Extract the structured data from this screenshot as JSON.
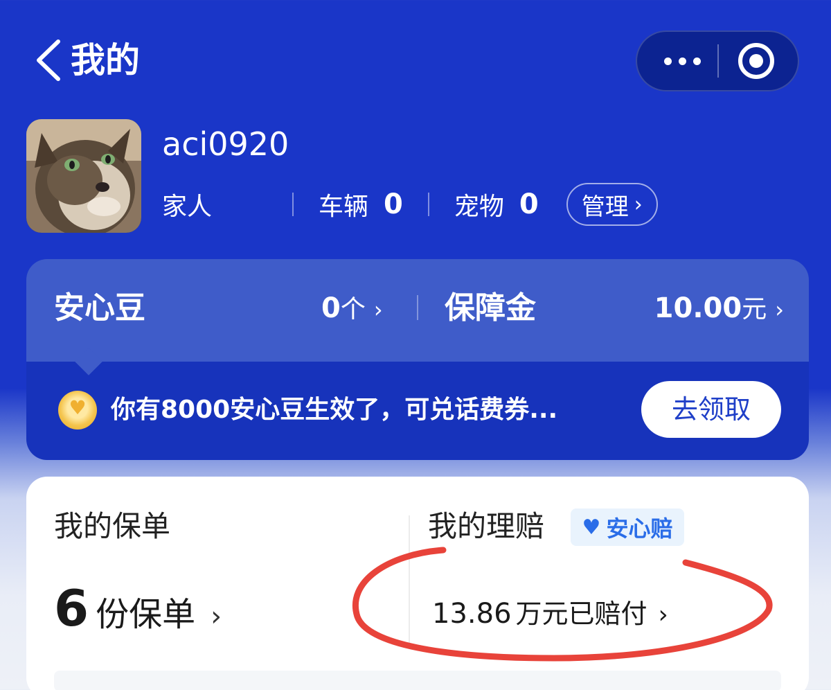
{
  "header": {
    "title": "我的"
  },
  "profile": {
    "username": "aci0920",
    "family_label": "家人",
    "vehicle_label": "车辆",
    "vehicle_count": "0",
    "pet_label": "宠物",
    "pet_count": "0",
    "manage_label": "管理"
  },
  "assets": {
    "beans_label": "安心豆",
    "beans_value": "0",
    "beans_unit": "个",
    "fund_label": "保障金",
    "fund_value": "10.00",
    "fund_unit": "元",
    "notice": "你有8000安心豆生效了，可兑话费券...",
    "claim_button": "去领取"
  },
  "policies": {
    "title": "我的保单",
    "count": "6",
    "count_unit": "份保单"
  },
  "claims": {
    "title": "我的理赔",
    "badge": "安心赔",
    "amount": "13.86",
    "amount_unit": "万元已赔付"
  },
  "icons": {
    "back": "chevron-left-icon",
    "more": "more-dots-icon",
    "close": "target-circle-icon",
    "chevron": "chevron-right-icon",
    "coin": "coin-icon",
    "shield": "shield-heart-icon"
  },
  "colors": {
    "primary_blue": "#1a36c8",
    "annotation_red": "#e8433a"
  }
}
